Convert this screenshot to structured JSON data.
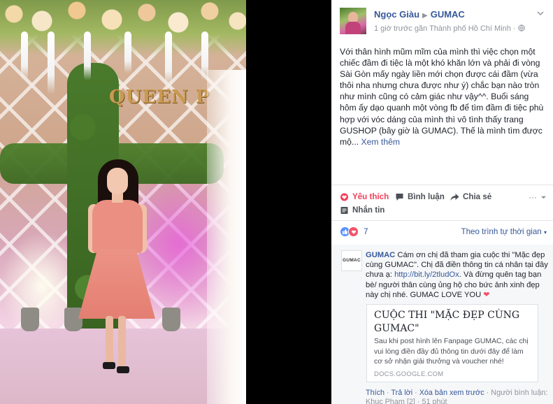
{
  "post": {
    "author": "Ngọc Giàu",
    "page": "GUMAC",
    "time": "1 giờ trước",
    "location": "gần Thành phố Hồ Chí Minh",
    "body": "Với thân hình mũm mĩm của mình thì việc chọn một chiếc đầm đi tiệc là một khó khăn lớn và phải đi vòng Sài Gòn mấy ngày liền mới chọn được cái đầm (vừa thôi nha nhưng chưa được như ý) chắc bạn nào tròn như mình cũng có cảm giác như vậy^^. Buổi sáng hôm ấy dạo quanh một vòng fb để tìm đầm đi tiệc phù hợp với vóc dáng của mình thì vô tình thấy trang GUSHOP (bây giờ là GUMAC). Thế là mình tìm được mộ...",
    "see_more": "Xem thêm"
  },
  "photo": {
    "sign_text": "QUEEN P"
  },
  "actions": {
    "like": "Yêu thích",
    "comment": "Bình luận",
    "share": "Chia sẻ",
    "message": "Nhắn tin"
  },
  "reactions": {
    "count": "7",
    "sort": "Theo trình tự thời gian"
  },
  "comment": {
    "avatar_label": "GUMAC",
    "author": "GUMAC",
    "text_1": "Cám ơn chị đã tham gia cuộc thi \"Mặc đẹp cùng GUMAC\". Chị đã điền thông tin cá nhân tại đây chưa ạ:",
    "link": "http://bit.ly/2tludOx",
    "text_2": ". Và đừng quên tag bạn bè/ người thân cùng ủng hộ cho bức ảnh xinh đẹp này chị nhé. GUMAC LOVE YOU",
    "heart": "❤",
    "card": {
      "title": "CUỘC THI \"MẶC ĐẸP CÙNG GUMAC\"",
      "description": "Sau khi post hình lên Fanpage GUMAC, các chị vui lòng điền đầy đủ thông tin dưới đây để làm cơ sở nhận giải thưởng và voucher nhé!",
      "domain": "DOCS.GOOGLE.COM"
    },
    "footer": {
      "like": "Thích",
      "reply": "Trả lời",
      "remove_preview": "Xóa bản xem trước",
      "replier": "Người bình luận: Khuc Pham",
      "replier_count": "[2]",
      "time": "51 phút"
    }
  }
}
